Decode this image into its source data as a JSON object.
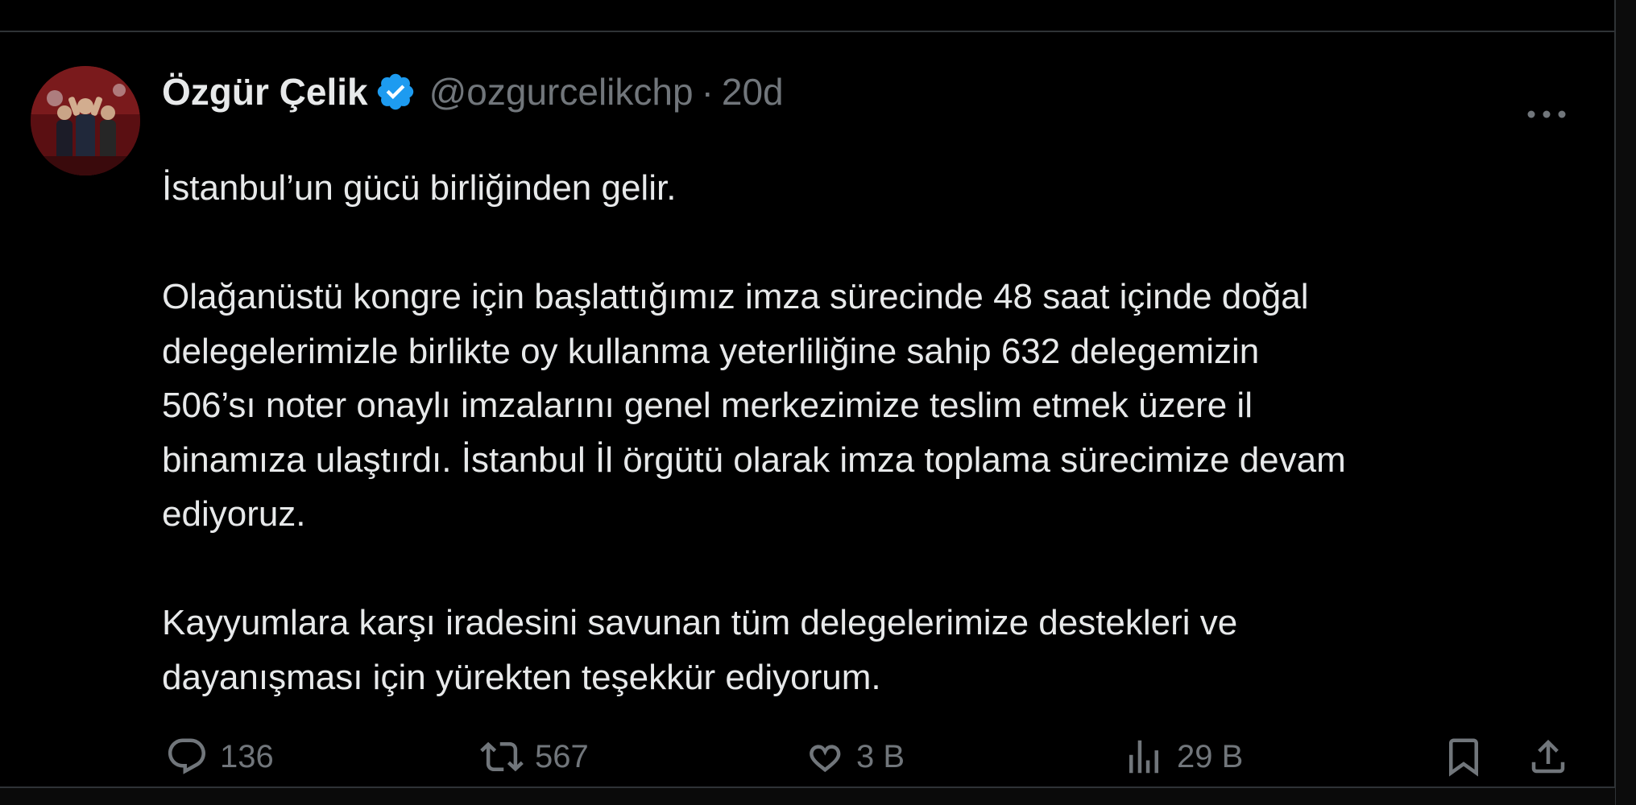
{
  "tweet": {
    "author": {
      "name": "Özgür Çelik",
      "handle": "@ozgurcelikchp",
      "verified_icon": "verified-badge-icon"
    },
    "separator": "·",
    "time": "20d",
    "paragraphs": [
      "İstanbul’un gücü birliğinden gelir.",
      "Olağanüstü kongre için başlattığımız imza sürecinde 48 saat içinde doğal\ndelegelerimizle birlikte oy kullanma yeterliliğine sahip 632 delegemizin\n506’sı noter onaylı imzalarını genel merkezimize teslim etmek üzere il\nbinamıza ulaştırdı. İstanbul İl örgütü olarak imza toplama sürecimize devam\nediyoruz.",
      "Kayyumlara karşı iradesini savunan tüm delegelerimize destekleri ve\ndayanışması için yürekten teşekkür ediyorum."
    ],
    "actions": {
      "replies": "136",
      "reposts": "567",
      "likes": "3 B",
      "views": "29 B"
    }
  },
  "colors": {
    "background": "#000000",
    "text": "#e7e9ea",
    "muted": "#71767b",
    "border": "#2f3336",
    "verified": "#1d9bf0"
  }
}
